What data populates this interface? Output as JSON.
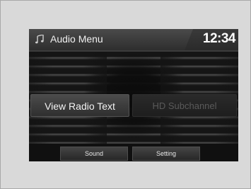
{
  "header": {
    "title": "Audio Menu",
    "clock": "12:34",
    "icon": "music-note-icon"
  },
  "menu": {
    "view_radio_text": "View Radio Text",
    "hd_subchannel": "HD Subchannel"
  },
  "bottom_bar": {
    "sound": "Sound",
    "setting": "Setting"
  }
}
